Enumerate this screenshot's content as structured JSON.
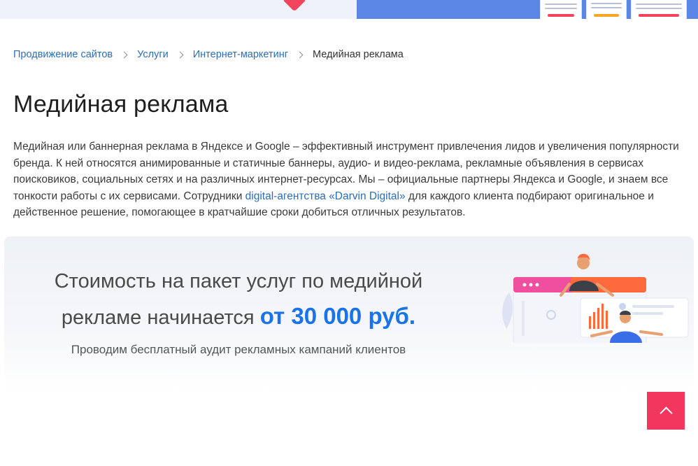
{
  "breadcrumb": {
    "items": [
      {
        "label": "Продвижение сайтов"
      },
      {
        "label": "Услуги"
      },
      {
        "label": "Интернет-маркетинг"
      }
    ],
    "current": "Медийная реклама"
  },
  "page": {
    "title": "Медийная реклама",
    "intro_part1": "Медийная или баннерная реклама в Яндексе и Google – эффективный инструмент привлечения лидов и увеличения популярности бренда. К ней относятся анимированные и статичные баннеры, аудио- и видео-реклама, рекламные объявления в сервисах поисковиков, социальных сетях и на различных интернет-ресурсах. Мы – официальные партнеры Яндекса и Google, и знаем все тонкости работы с их сервисами. Сотрудники ",
    "intro_link": "digital-агентства «Darvin Digital»",
    "intro_part2": " для каждого клиента подбирают оригинальное и действенное решение, помогающее в кратчайшие сроки добиться отличных результатов."
  },
  "price": {
    "line1": "Стоимость на пакет услуг по медийной",
    "line2_prefix": "рекламе начинается ",
    "line2_accent": "от 30 000 руб.",
    "note": "Проводим бесплатный аудит рекламных кампаний клиентов"
  },
  "colors": {
    "accent_blue": "#1a73e8",
    "link_blue": "#2d6db4",
    "scroll_button_red": "#f2365d"
  }
}
